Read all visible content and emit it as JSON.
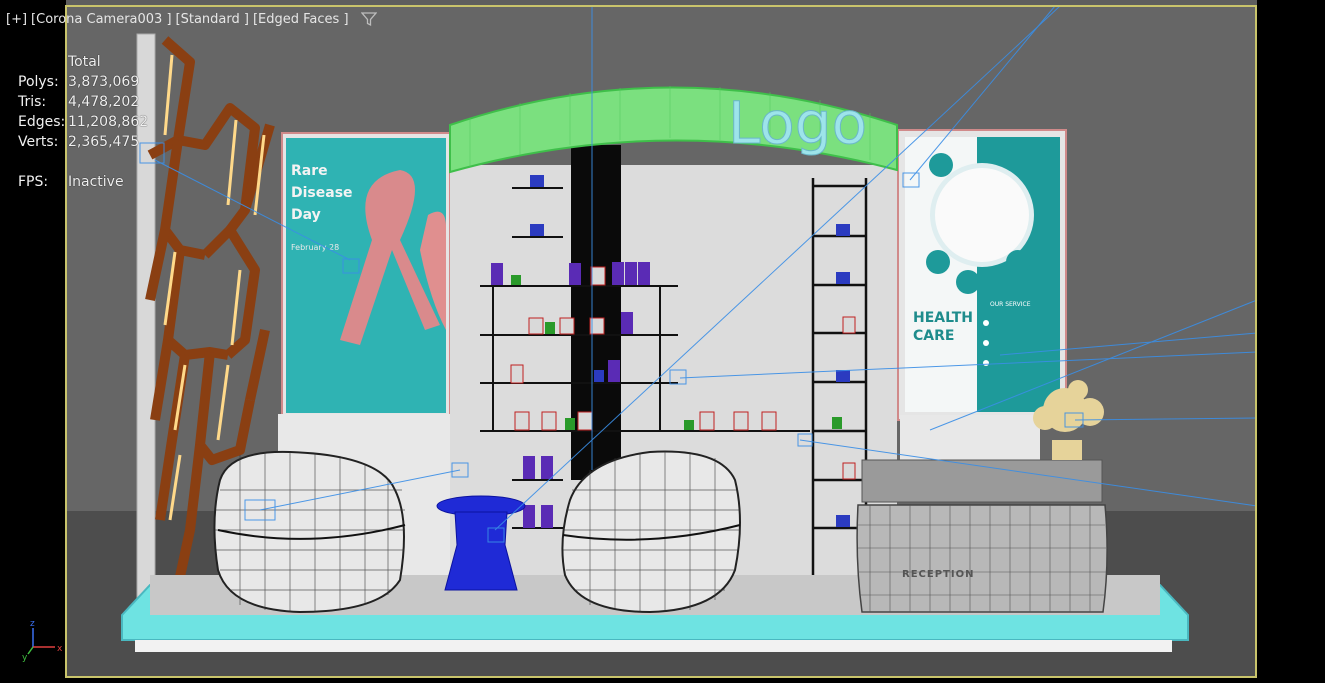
{
  "viewport": {
    "header": [
      "[+]",
      "[Corona Camera003 ]",
      "[Standard ]",
      "[Edged Faces ]"
    ],
    "filter_icon": "funnel-filter-icon",
    "frame_color": "#c9c46b"
  },
  "stats": {
    "column": "Total",
    "rows": [
      {
        "label": "Polys:",
        "value": "3,873,069"
      },
      {
        "label": "Tris:",
        "value": "4,478,202"
      },
      {
        "label": "Edges:",
        "value": "11,208,862"
      },
      {
        "label": "Verts:",
        "value": "2,365,475"
      }
    ],
    "fps_label": "FPS:",
    "fps_value": "Inactive"
  },
  "scene": {
    "logo_text": "Logo",
    "left_poster": {
      "title": [
        "Rare",
        "Disease",
        "Day"
      ],
      "date": "February 28"
    },
    "right_poster": {
      "title": [
        "HEALTH",
        "CARE"
      ],
      "subtitle": "OUR SERVICE"
    },
    "reception_label": "RECEPTION",
    "colors": {
      "poster_bg": "#2fb3b3",
      "canopy": "#72e07a",
      "platform_edge": "#5fe0df",
      "stool": "#1f2ad6"
    }
  },
  "axis_gizmo": {
    "x": "x",
    "y": "y",
    "z": "z"
  }
}
